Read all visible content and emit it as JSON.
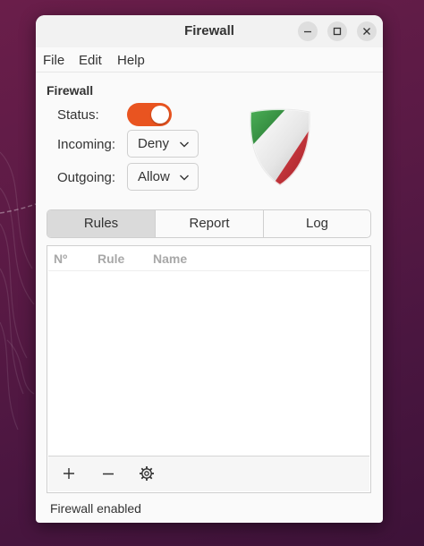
{
  "window": {
    "title": "Firewall"
  },
  "menu": {
    "items": [
      "File",
      "Edit",
      "Help"
    ]
  },
  "firewall_section": {
    "title": "Firewall",
    "status_label": "Status:",
    "status_enabled": true,
    "incoming_label": "Incoming:",
    "incoming_value": "Deny",
    "outgoing_label": "Outgoing:",
    "outgoing_value": "Allow"
  },
  "tabs": [
    {
      "label": "Rules",
      "selected": true
    },
    {
      "label": "Report",
      "selected": false
    },
    {
      "label": "Log",
      "selected": false
    }
  ],
  "rules_table": {
    "columns": [
      "Nº",
      "Rule",
      "Name"
    ],
    "rows": []
  },
  "toolbar": {
    "icons": [
      "add-icon",
      "remove-icon",
      "edit-gear-icon"
    ]
  },
  "statusbar": {
    "text": "Firewall enabled"
  },
  "colors": {
    "accent": "#e95420",
    "shield_green": "#2f8a3a",
    "shield_red": "#c9303a"
  }
}
